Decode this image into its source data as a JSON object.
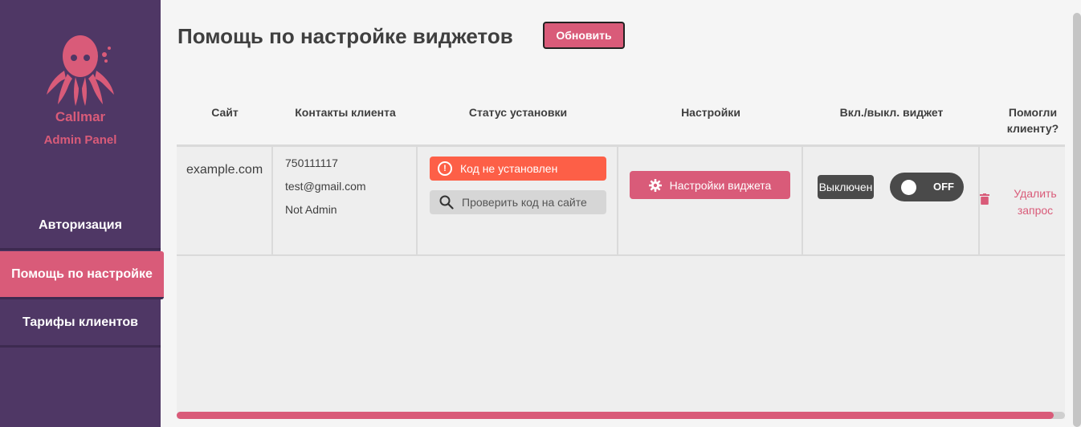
{
  "brand": {
    "name": "Callmar",
    "subtitle": "Admin Panel"
  },
  "sidebar": {
    "items": [
      {
        "label": "Авторизация",
        "active": false
      },
      {
        "label": "Помощь по настройке",
        "active": true
      },
      {
        "label": "Тарифы клиентов",
        "active": false
      }
    ]
  },
  "header": {
    "title": "Помощь по настройке виджетов",
    "refresh_label": "Обновить"
  },
  "table": {
    "columns": [
      "Сайт",
      "Контакты клиента",
      "Статус установки",
      "Настройки",
      "Вкл./выкл. виджет",
      "Помогли клиенту?"
    ],
    "rows": [
      {
        "site": "example.com",
        "contacts": [
          "750111117",
          "test@gmail.com",
          "Not Admin"
        ],
        "status": "Код не установлен",
        "check_label": "Проверить код на сайте",
        "settings_label": "Настройки виджета",
        "widget_state": "Выключен",
        "toggle_label": "OFF",
        "delete_label": "Удалить запрос"
      }
    ]
  },
  "colors": {
    "sidebar": "#4f3765",
    "accent": "#d95b79",
    "error": "#fd5f47",
    "dark": "#4a4a4a"
  },
  "icons": [
    "octopus-logo-icon",
    "alert-circle-icon",
    "search-icon",
    "gear-icon",
    "trash-icon"
  ]
}
